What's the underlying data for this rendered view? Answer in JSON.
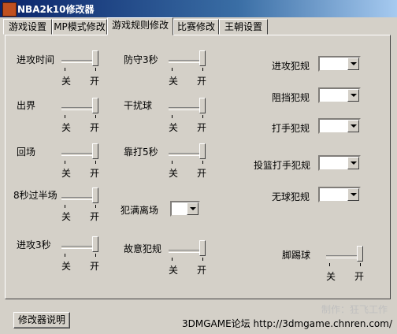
{
  "window": {
    "title": "NBA2k10修改器"
  },
  "tabs": [
    {
      "label": "游戏设置"
    },
    {
      "label": "MP模式修改"
    },
    {
      "label": "游戏规则修改"
    },
    {
      "label": "比赛修改"
    },
    {
      "label": "王朝设置"
    }
  ],
  "active_tab": "游戏规则修改",
  "slider_ticks": {
    "off": "关",
    "on": "开"
  },
  "sliders": [
    {
      "label": "进攻时间",
      "value": "开"
    },
    {
      "label": "出界",
      "value": "开"
    },
    {
      "label": "回场",
      "value": "开"
    },
    {
      "label": "8秒过半场",
      "value": "开"
    },
    {
      "label": "进攻3秒",
      "value": "开"
    },
    {
      "label": "防守3秒",
      "value": "开"
    },
    {
      "label": "干扰球",
      "value": "开"
    },
    {
      "label": "靠打5秒",
      "value": "开"
    },
    {
      "label": "故意犯规",
      "value": "开"
    },
    {
      "label": "脚踢球",
      "value": "开"
    }
  ],
  "combos": [
    {
      "label": "犯满离场",
      "value": ""
    },
    {
      "label": "进攻犯规",
      "value": ""
    },
    {
      "label": "阻挡犯规",
      "value": ""
    },
    {
      "label": "打手犯规",
      "value": ""
    },
    {
      "label": "投篮打手犯规",
      "value": ""
    },
    {
      "label": "无球犯规",
      "value": ""
    }
  ],
  "buttons": {
    "help": "修改器说明"
  },
  "footer": {
    "site": "3DMGAME论坛 http://3dmgame.chnren.com/",
    "credit": "制作：狂飞工作"
  }
}
